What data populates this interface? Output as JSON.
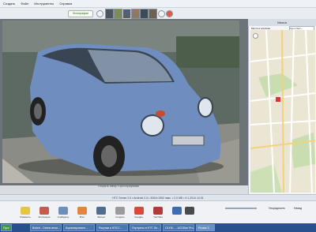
{
  "menu": [
    "Создать",
    "Файл",
    "Инструменты",
    "Справка"
  ],
  "toolbar": {
    "geotag_label": "Фотографии"
  },
  "sidebar": {
    "title": "Места",
    "places_label": "Места в альбоме фотографии",
    "search_placeholder": "Где я был..."
  },
  "status_line": "HTC Sense 2.0 • Android 2.3 • 3264×1952 пикс. • 2,0 МБ • 9.1.2014 14:31",
  "photo_caption": "Открыть папку с фотографиями",
  "bottom_tools": [
    "Изменить",
    "Коллекция",
    "Слайдшоу",
    "Блог",
    "Фильм",
    "Создать",
    "Google+",
    "YouTube"
  ],
  "bottom_right": [
    "Упорядочить",
    "Назад"
  ],
  "taskbar": [
    "Пуск",
    "Bokeh - Осени вели...",
    "Корзинированн...",
    "Рисунки и КПСС...",
    "Портреты в НТС Se...",
    "OLYM... - ACDSee Pro...",
    "Picasa 3"
  ],
  "colors": {
    "car": "#6f8dbf",
    "taskbar": "#2a4f8f"
  }
}
